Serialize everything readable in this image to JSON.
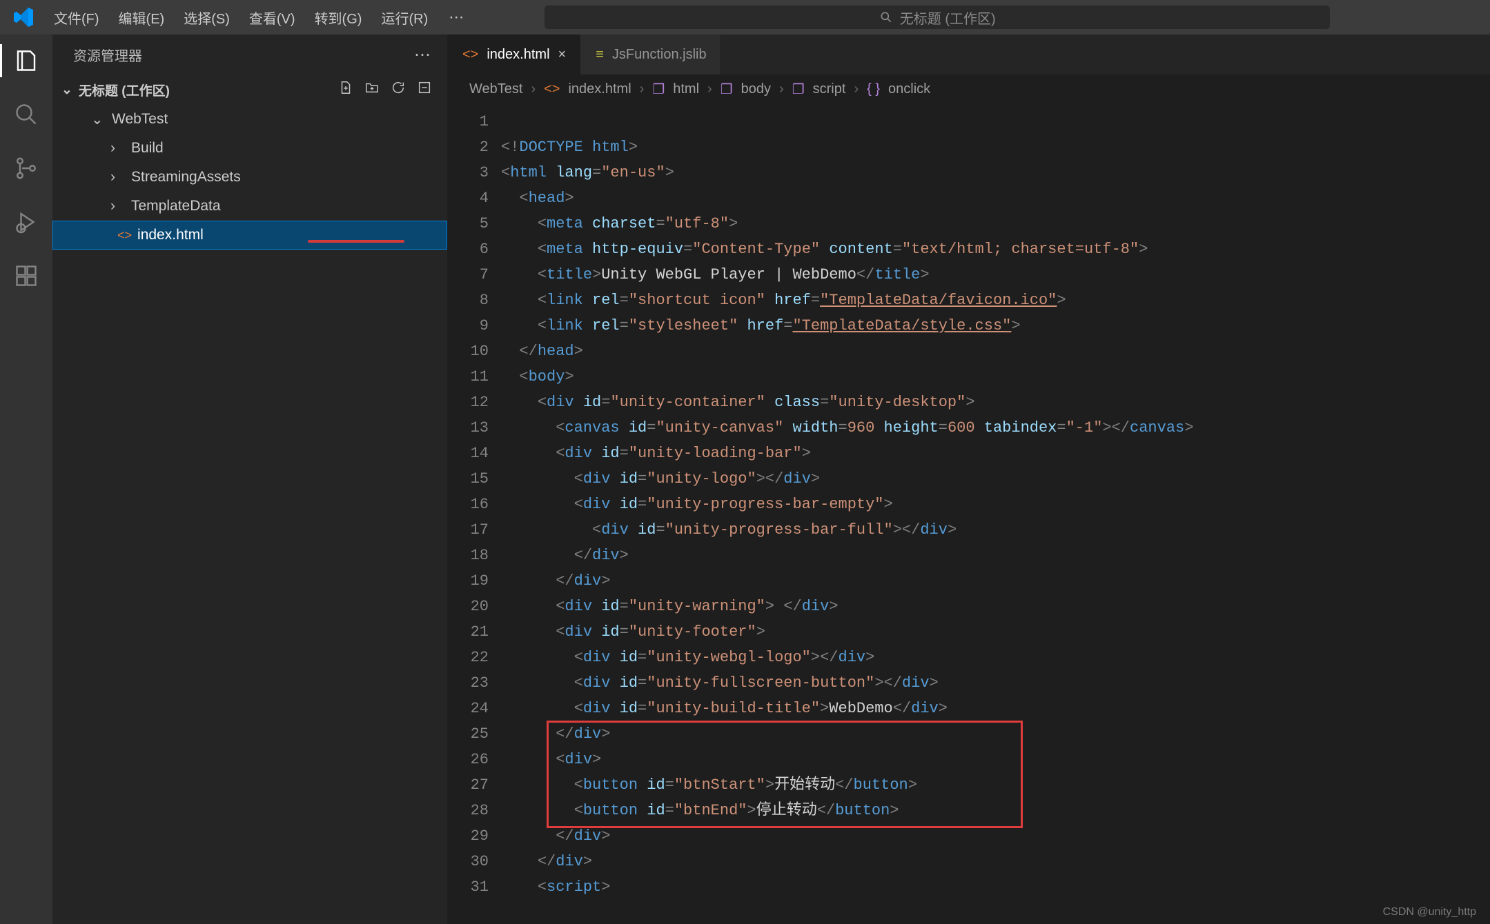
{
  "titlebar": {
    "menu": [
      "文件(F)",
      "编辑(E)",
      "选择(S)",
      "查看(V)",
      "转到(G)",
      "运行(R)"
    ],
    "search_text": "无标题 (工作区)"
  },
  "sidebar": {
    "title": "资源管理器",
    "section_title": "无标题 (工作区)",
    "tree": {
      "project": "WebTest",
      "folders": [
        "Build",
        "StreamingAssets",
        "TemplateData"
      ],
      "file": "index.html"
    }
  },
  "tabs": [
    {
      "label": "index.html",
      "type": "html",
      "active": true
    },
    {
      "label": "JsFunction.jslib",
      "type": "js",
      "active": false
    }
  ],
  "breadcrumbs": {
    "p0": "WebTest",
    "p1": "index.html",
    "p2": "html",
    "p3": "body",
    "p4": "script",
    "p5": "onclick"
  },
  "code": {
    "lines": [
      1,
      2,
      3,
      4,
      5,
      6,
      7,
      8,
      9,
      10,
      11,
      12,
      13,
      14,
      15,
      16,
      17,
      18,
      19,
      20,
      21,
      22,
      23,
      24,
      25,
      26,
      27,
      28,
      29,
      30,
      31
    ],
    "l1_doctype": "DOCTYPE",
    "l1_html": "html",
    "l2_lang_val": "\"en-us\"",
    "l4_charset_val": "\"utf-8\"",
    "l5_equiv_val": "\"Content-Type\"",
    "l5_content_val": "\"text/html; charset=utf-8\"",
    "l6_title_text": "Unity WebGL Player | WebDemo",
    "l7_rel_val": "\"shortcut icon\"",
    "l7_href_val": "\"TemplateData/favicon.ico\"",
    "l8_rel_val": "\"stylesheet\"",
    "l8_href_val": "\"TemplateData/style.css\"",
    "l11_id_val": "\"unity-container\"",
    "l11_class_val": "\"unity-desktop\"",
    "l12_id_val": "\"unity-canvas\"",
    "l12_width_val": "960",
    "l12_height_val": "600",
    "l12_tab_val": "\"-1\"",
    "l13_id_val": "\"unity-loading-bar\"",
    "l14_id_val": "\"unity-logo\"",
    "l15_id_val": "\"unity-progress-bar-empty\"",
    "l16_id_val": "\"unity-progress-bar-full\"",
    "l19_id_val": "\"unity-warning\"",
    "l20_id_val": "\"unity-footer\"",
    "l21_id_val": "\"unity-webgl-logo\"",
    "l22_id_val": "\"unity-fullscreen-button\"",
    "l23_id_val": "\"unity-build-title\"",
    "l23_text": "WebDemo",
    "l26_id_val": "\"btnStart\"",
    "l26_text": "开始转动",
    "l27_id_val": "\"btnEnd\"",
    "l27_text": "停止转动"
  },
  "watermark": "CSDN @unity_http"
}
